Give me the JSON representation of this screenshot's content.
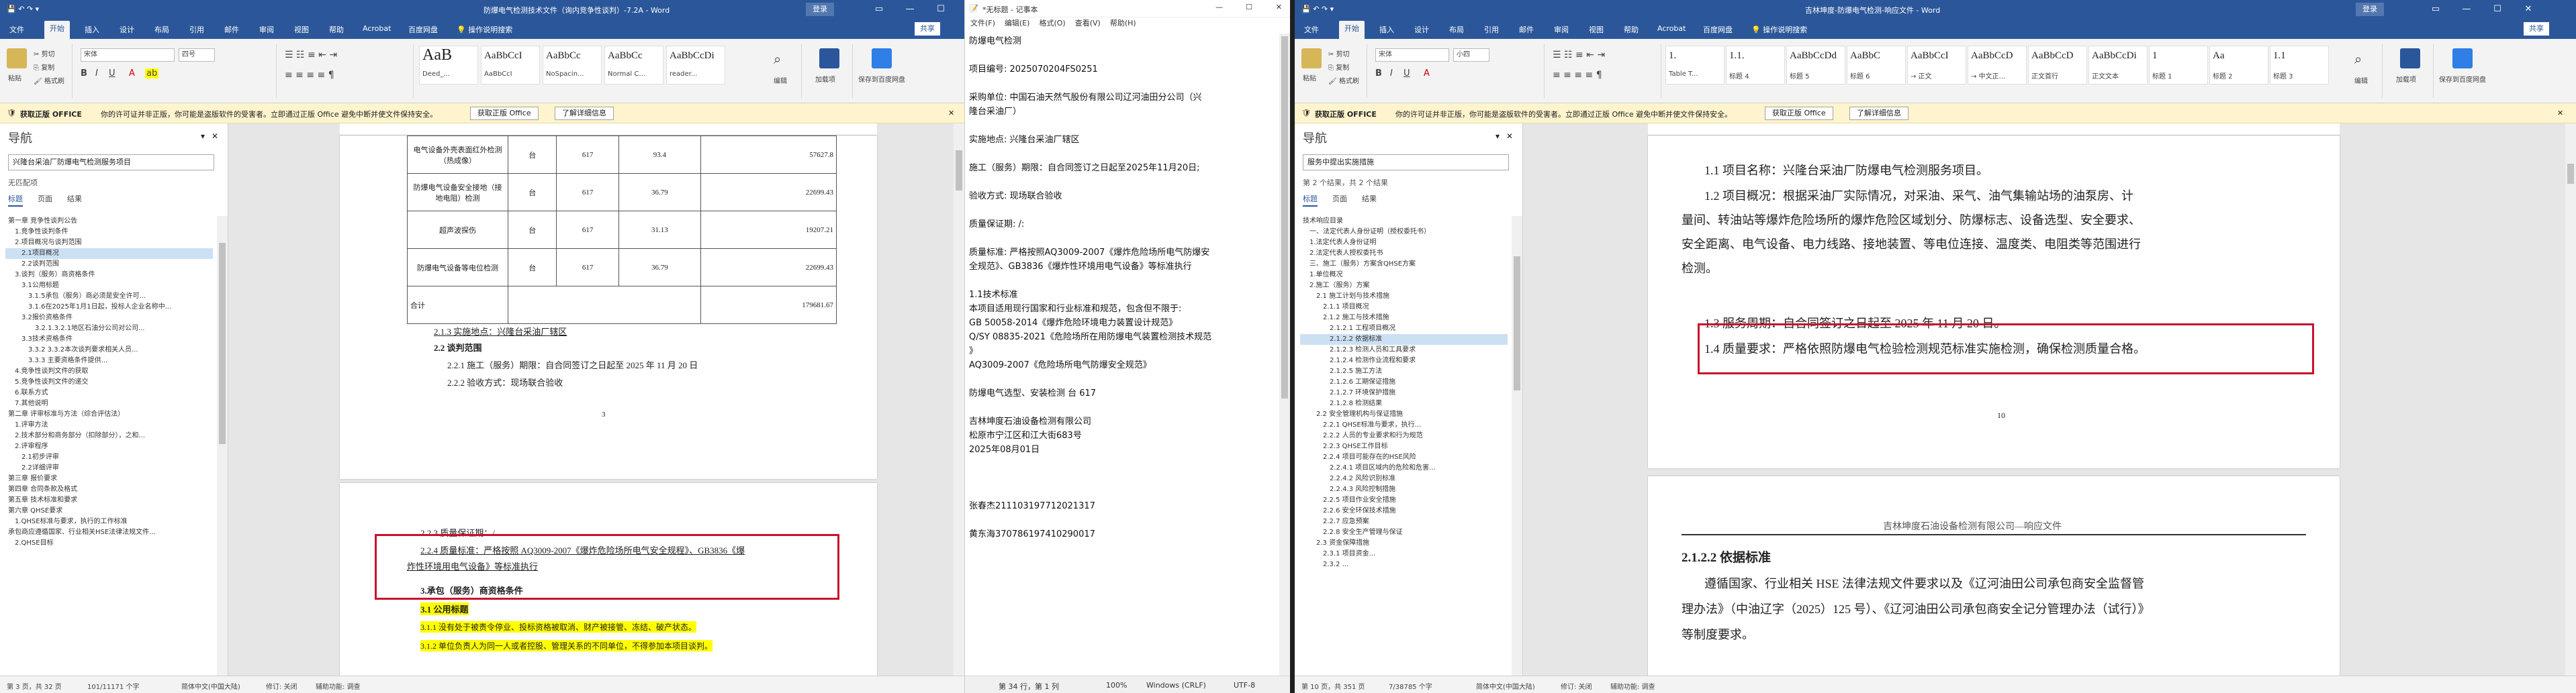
{
  "win1": {
    "title": "防爆电气检测技术文件（询内竞争性谈判）-7.2A - Word",
    "signin": "登录",
    "share_label": "共享",
    "menu": [
      "文件",
      "开始",
      "插入",
      "设计",
      "布局",
      "引用",
      "邮件",
      "审阅",
      "视图",
      "帮助",
      "Acrobat",
      "百度网盘",
      "操作说明搜索"
    ],
    "font_name": "宋体",
    "font_size": "四号",
    "clipboard": {
      "paste": "粘贴",
      "cut": "剪切",
      "copy": "复制",
      "format": "格式刷"
    },
    "styles": [
      {
        "preview": "AaB",
        "name": "Deed_..."
      },
      {
        "preview": "AaBbCcI",
        "name": "AaBbCcI"
      },
      {
        "preview": "AaBbCc",
        "name": "NoSpacin..."
      },
      {
        "preview": "AaBbCc",
        "name": "Normal C..."
      },
      {
        "preview": "AaBbCcDi",
        "name": "reader..."
      }
    ],
    "edit_label": "编辑",
    "addon1": "加载项",
    "addon2": "保存到百度网盘",
    "infobar": {
      "label": "获取正版 OFFICE",
      "text": "你的许可证并非正版，你可能是盗版软件的受害者。立即通过正版 Office 避免中断并使文件保持安全。",
      "btn1": "获取正版 Office",
      "btn2": "了解详细信息"
    },
    "nav": {
      "title": "导航",
      "search": "兴隆台采油厂防爆电气检测服务项目",
      "result": "无匹配项",
      "tabs": [
        "标题",
        "页面",
        "结果"
      ]
    },
    "outline": [
      "第一章 竞争性谈判公告",
      "1.竞争性谈判条件",
      "2.项目概况与谈判范围",
      "2.1项目概况",
      "2.2谈判范围",
      "3.谈判（服务）商资格条件",
      "3.1公用标题",
      "3.1.5承包（服务）商必须是安全许可...",
      "3.1.6在2025年1月1日起，投标人企业名称中...",
      "3.2报价资格条件",
      "3.2.1.3.2.1地区石油分公司对公司...",
      "3.3技术资格条件",
      "3.3.2 3.3.2本次谈判要求相关人员...",
      "3.3.3 主要资格条件提供...",
      "4.竞争性谈判文件的获取",
      "5.竞争性谈判文件的递交",
      "6.联系方式",
      "7.其他说明",
      "第二章 评审标准与方法（综合评估法）",
      "1.评审方法",
      "2.技术部分和商务部分（扣除部分），之和...",
      "2.评审程序",
      "2.1初步评审",
      "2.2详细评审",
      "第三章 报价要求",
      "第四章 合同条款及格式",
      "第五章 技术标准和要求",
      "第六章 QHSE要求",
      "1.QHSE标准与要求，执行的工作标准",
      "承包商应遵循国家、行业相关HSE法律法规文件...",
      "2.QHSE目标"
    ],
    "table_rows": [
      {
        "name": "电气设备外壳表面红外检测（热成像）",
        "unit": "台",
        "qty": "617",
        "price": "93.4",
        "total": "57627.8"
      },
      {
        "name": "防爆电气设备安全接地（接地电阻）检测",
        "unit": "台",
        "qty": "617",
        "price": "36.79",
        "total": "22699.43"
      },
      {
        "name": "超声波探伤",
        "unit": "台",
        "qty": "617",
        "price": "31.13",
        "total": "19207.21"
      },
      {
        "name": "防爆电气设备等电位检测",
        "unit": "台",
        "qty": "617",
        "price": "36.79",
        "total": "22699.43"
      }
    ],
    "table_total": {
      "label": "合计",
      "total": "179681.67"
    },
    "doc_lines": {
      "l1": "2.1.3 实施地点：兴隆台采油厂辖区",
      "l2": "2.2 谈判范围",
      "l3": "2.2.1 施工（服务）期限：自合同签订之日起至 2025 年 11 月 20 日",
      "l4": "2.2.2 验收方式：现场联合验收",
      "page_no": "3",
      "l5": "2.2.3 质量保证期：/",
      "l6": "2.2.4 质量标准：严格按照 AQ3009-2007《爆炸危险场所电气安全规程》、GB3836《爆",
      "l7": "炸性环境用电气设备》等标准执行",
      "l8": "3.承包（服务）商资格条件",
      "l9": "3.1 公用标题",
      "l10": "3.1.1 没有处于被责令停业、投标资格被取消、财产被接管、冻结、破产状态。",
      "l11": "3.1.2 单位负责人为同一人或者控股、管理关系的不同单位，不得参加本项目谈判。"
    },
    "status": {
      "page": "第 3 页，共 32 页",
      "words": "101/11171 个字",
      "lang": "简体中文(中国大陆)",
      "track": "修订: 关闭",
      "access": "辅助功能: 调查"
    }
  },
  "notepad": {
    "title": "*无标题 - 记事本",
    "menu": [
      "文件(F)",
      "编辑(E)",
      "格式(O)",
      "查看(V)",
      "帮助(H)"
    ],
    "lines": [
      "防爆电气检测",
      "",
      "项目编号:   2025070204FS0251",
      "",
      "采购单位:  中国石油天然气股份有限公司辽河油田分公司（兴",
      "隆台采油厂）",
      "",
      "实施地点:  兴隆台采油厂辖区",
      "",
      "施工（服务）期限：自合同签订之日起至2025年11月20日;",
      "",
      "验收方式:  现场联合验收",
      "",
      "质量保证期:  /:",
      "",
      "质量标准:  严格按照AQ3009-2007《爆炸危险场所电气防爆安",
      "全规范》、GB3836《爆炸性环境用电气设备》等标准执行",
      "",
      "1.1技术标准",
      "本项目适用现行国家和行业标准和规范，包含但不限于:",
      "GB 50058-2014《爆炸危险环境电力装置设计规范》",
      "Q/SY 08835-2021《危险场所在用防爆电气装置检测技术规范",
      "》",
      "AQ3009-2007《危险场所电气防爆安全规范》",
      "",
      "防爆电气选型、安装检测          台          617",
      "",
      "吉林坤度石油设备检测有限公司",
      "松原市宁江区和江大街683号",
      "2025年08月01日",
      "",
      "",
      "",
      "张春杰211103197712021317",
      "",
      "黄东海370786197410290017"
    ],
    "status": {
      "pos": "第 34 行，第 1 列",
      "zoom": "100%",
      "eol": "Windows (CRLF)",
      "enc": "UTF-8"
    }
  },
  "win2": {
    "title": "吉林坤度-防爆电气检测-响应文件 - Word",
    "signin": "登录",
    "share_label": "共享",
    "menu": [
      "文件",
      "开始",
      "插入",
      "设计",
      "布局",
      "引用",
      "邮件",
      "审阅",
      "视图",
      "帮助",
      "Acrobat",
      "百度网盘",
      "操作说明搜索"
    ],
    "font_name": "宋体",
    "font_size": "小四",
    "clipboard": {
      "paste": "粘贴",
      "cut": "剪切",
      "copy": "复制",
      "format": "格式刷"
    },
    "styles": [
      {
        "preview": "1.",
        "name": "Table T..."
      },
      {
        "preview": "1.1.",
        "name": "标题 4"
      },
      {
        "preview": "AaBbCcDd",
        "name": "标题 5"
      },
      {
        "preview": "AaBbC",
        "name": "标题 6"
      },
      {
        "preview": "AaBbCcI",
        "name": "→ 正文"
      },
      {
        "preview": "AaBbCcD",
        "name": "→ 中文正..."
      },
      {
        "preview": "AaBbCcD",
        "name": "正文首行"
      },
      {
        "preview": "AaBbCcDi",
        "name": "正文文本"
      },
      {
        "preview": "1",
        "name": "标题 1"
      },
      {
        "preview": "Aa",
        "name": "标题 2"
      },
      {
        "preview": "1.1",
        "name": "标题 3"
      }
    ],
    "edit_label": "编辑",
    "addon1": "加载项",
    "addon2": "保存到百度网盘",
    "infobar": {
      "label": "获取正版 OFFICE",
      "text": "你的许可证并非正版，你可能是盗版软件的受害者。立即通过正版 Office 避免中断并使文件保持安全。",
      "btn1": "获取正版 Office",
      "btn2": "了解详细信息"
    },
    "nav": {
      "title": "导航",
      "search": "服务中提出实施措施",
      "result": "第 2 个结果，共 2 个结果",
      "tabs": [
        "标题",
        "页面",
        "结果"
      ]
    },
    "outline": [
      "技术响应目录",
      "一、法定代表人身份证明（授权委托书）",
      "1.法定代表人身份证明",
      "2.法定代表人授权委托书",
      "三、施工（服务）方案含QHSE方案",
      "1.单位概况",
      "2.施工（服务）方案",
      "2.1 施工计划与技术措施",
      "2.1.1 项目概况",
      "2.1.2 施工与技术措施",
      "2.1.2.1 工程项目概况",
      "2.1.2.2 依据标准",
      "2.1.2.3 检测人员和工具要求",
      "2.1.2.4 检测作业流程和要求",
      "2.1.2.5 施工方法",
      "2.1.2.6 工期保证措施",
      "2.1.2.7 环境保护措施",
      "2.1.2.8 检测结果",
      "2.2 安全管理机构与保证措施",
      "2.2.1 QHSE标准与要求，执行...",
      "2.2.2 人员的专业要求和行为规范",
      "2.2.3 QHSE工作目标",
      "2.2.4 项目可能存在的HSE风险",
      "2.2.4.1 项目区域内的危险和危害...",
      "2.2.4.2 风险识别标准",
      "2.2.4.3 风险控制措施",
      "2.2.5 项目作业安全措施",
      "2.2.6 安全环保技术措施",
      "2.2.7 应急预案",
      "2.2.8 安全生产管理与保证",
      "2.3 资金保障措施",
      "2.3.1 项目资金...",
      "2.3.2 ..."
    ],
    "doc_lines": {
      "a1": "1.1 项目名称：兴隆台采油厂防爆电气检测服务项目。",
      "a2": "1.2 项目概况：根据采油厂实际情况，对采油、采气、油气集输站场的油泵房、计",
      "a3": "量间、转油站等爆炸危险场所的爆炸危险区域划分、防爆标志、设备选型、安全要求、",
      "a4": "安全距离、电气设备、电力线路、接地装置、等电位连接、温度类、电阻类等范围进行",
      "a5": "检测。",
      "a6": "1.3 服务周期：自合同签订之日起至 2025 年 11 月 20 日。",
      "a7": "1.4 质量要求：严格依照防爆电气检验检测规范标准实施检测，确保检测质量合格。",
      "page_no": "10",
      "header": "吉林坤度石油设备检测有限公司—响应文件",
      "h": "2.1.2.2    依据标准",
      "b1": "遵循国家、行业相关 HSE 法律法规文件要求以及《辽河油田公司承包商安全监督管",
      "b2": "理办法》（中油辽字（2025）125 号）、《辽河油田公司承包商安全记分管理办法（试行）》",
      "b3": "等制度要求。"
    },
    "status": {
      "page": "第 10 页，共 351 页",
      "words": "7/38785 个字",
      "lang": "简体中文(中国大陆)",
      "track": "修订: 关闭",
      "access": "辅助功能: 调查"
    }
  },
  "colors": {
    "word_blue": "#2b579a",
    "highlight": "#ffff00",
    "red_box": "#c8102e",
    "info_bg": "#fff4ce"
  }
}
